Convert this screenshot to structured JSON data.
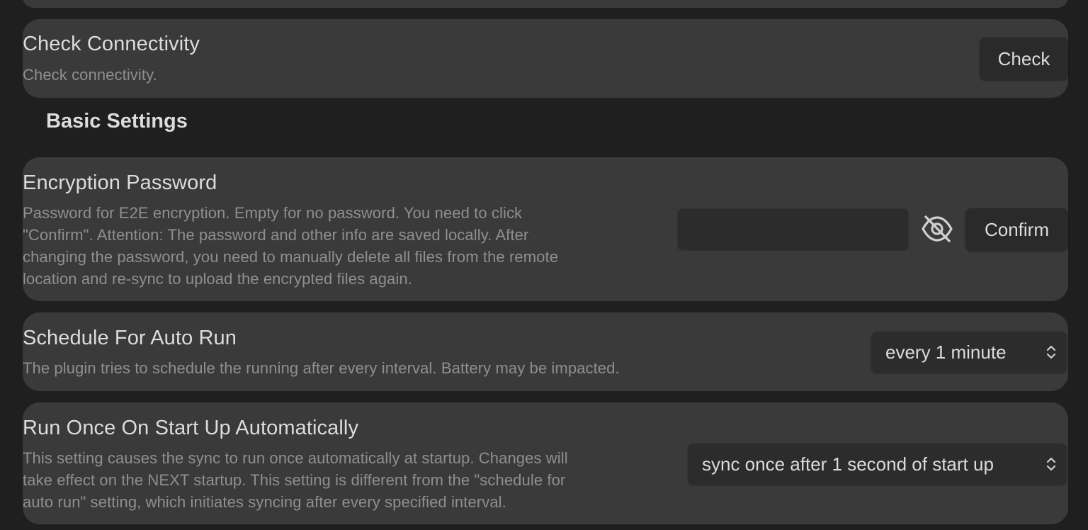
{
  "check_connectivity": {
    "title": "Check Connectivity",
    "description": "Check connectivity.",
    "button_label": "Check"
  },
  "section_heading": "Basic Settings",
  "encryption_password": {
    "title": "Encryption Password",
    "description_lines": [
      "Password for E2E encryption. Empty for no password. You need to click",
      "\"Confirm\". Attention: The password and other info are saved locally. After",
      "changing the password, you need to manually delete all files from the remote",
      "location and re-sync to upload the encrypted files again."
    ],
    "input_value": "",
    "toggle_icon": "eye-off-icon",
    "button_label": "Confirm"
  },
  "schedule_auto_run": {
    "title": "Schedule For Auto Run",
    "description": "The plugin tries to schedule the running after every interval. Battery may be impacted.",
    "selected_value": "every 1 minute"
  },
  "run_once_startup": {
    "title": "Run Once On Start Up Automatically",
    "description_lines": [
      "This setting causes the sync to run once automatically at startup. Changes will",
      "take effect on the NEXT startup. This setting is different from the \"schedule for",
      "auto run\" setting, which initiates syncing after every specified interval."
    ],
    "selected_value": "sync once after 1 second of start up"
  },
  "colors": {
    "page_background": "#1f1f1f",
    "card_background": "#3a3a3a",
    "control_background": "#2c2c2c",
    "title_text": "#dcdcdc",
    "description_text": "#8f8f8f"
  }
}
